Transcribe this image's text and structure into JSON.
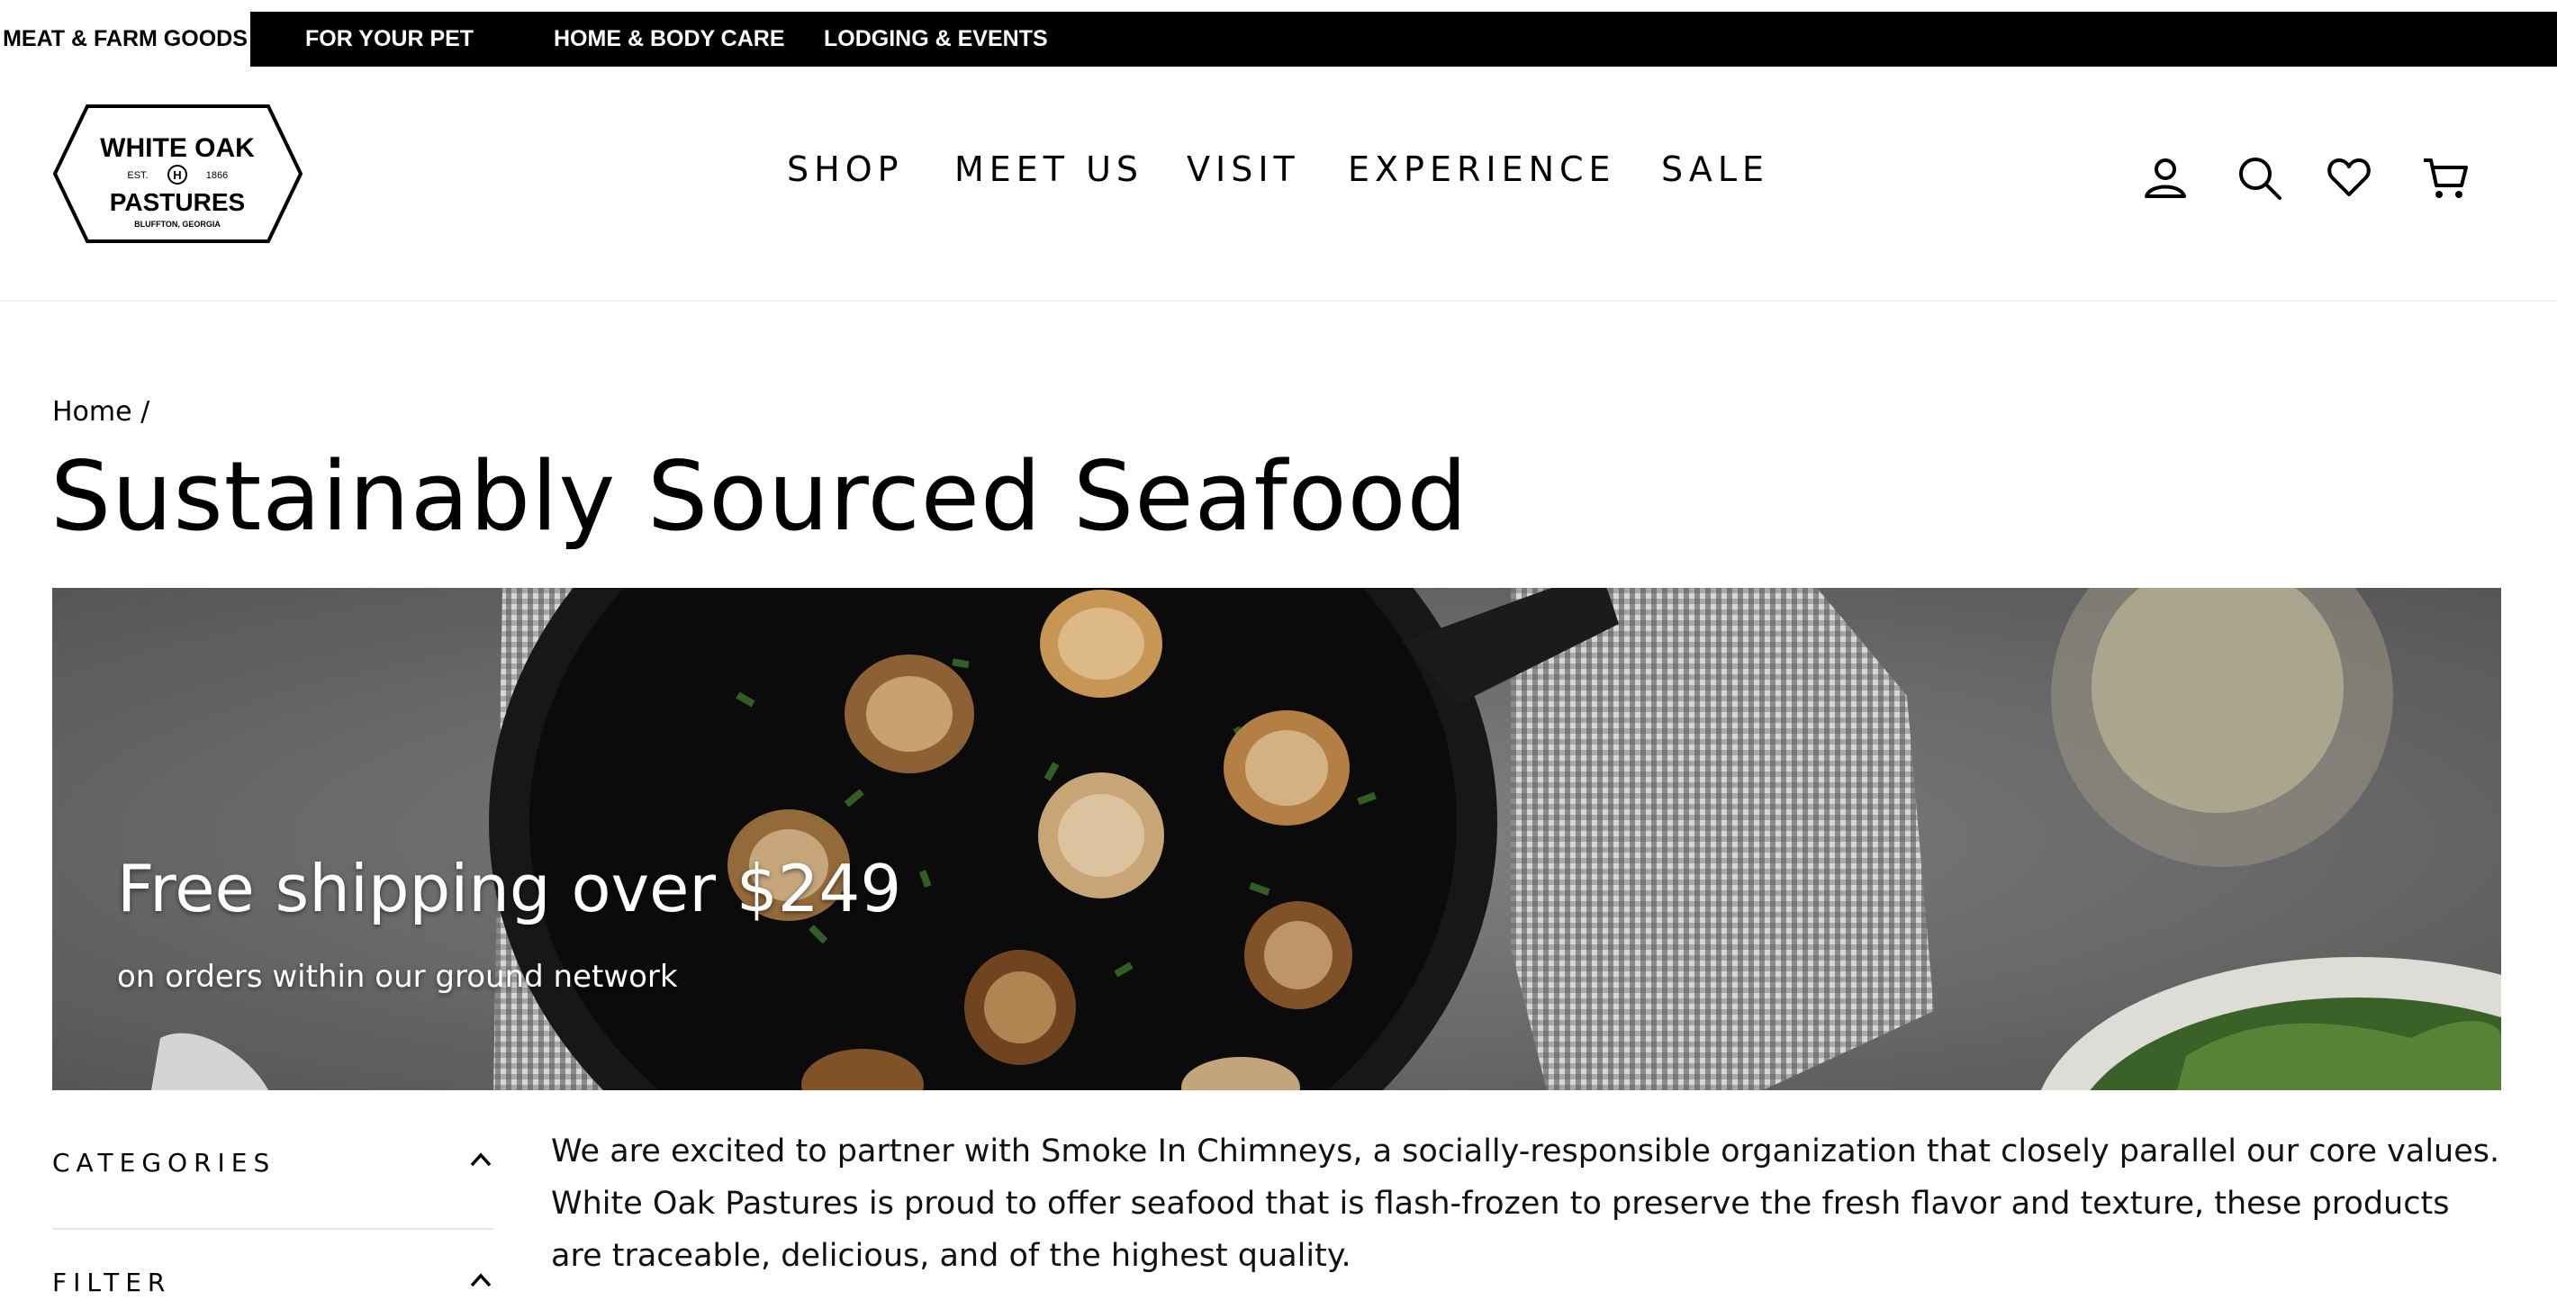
{
  "top_tabs": [
    "MEAT & FARM GOODS",
    "FOR YOUR PET",
    "HOME & BODY CARE",
    "LODGING & EVENTS"
  ],
  "logo": {
    "line1": "WHITE OAK",
    "est": "EST.",
    "year": "1866",
    "line2": "PASTURES",
    "line3": "BLUFFTON, GEORGIA"
  },
  "nav": [
    "SHOP",
    "MEET US",
    "VISIT",
    "EXPERIENCE",
    "SALE"
  ],
  "header_icons": [
    "account-icon",
    "search-icon",
    "heart-icon",
    "cart-icon"
  ],
  "breadcrumb": "Home /",
  "page_title": "Sustainably Sourced Seafood",
  "hero": {
    "title": "Free shipping over $249",
    "subtitle": "on orders within our ground network"
  },
  "sidebar": {
    "categories": "CATEGORIES",
    "filter": "FILTER"
  },
  "description": "We are excited to partner with Smoke In Chimneys, a socially-responsible organization that closely parallel our core values. White Oak Pastures is proud to offer seafood that is flash-frozen to preserve the fresh flavor and texture, these products are traceable, delicious, and of the highest quality."
}
